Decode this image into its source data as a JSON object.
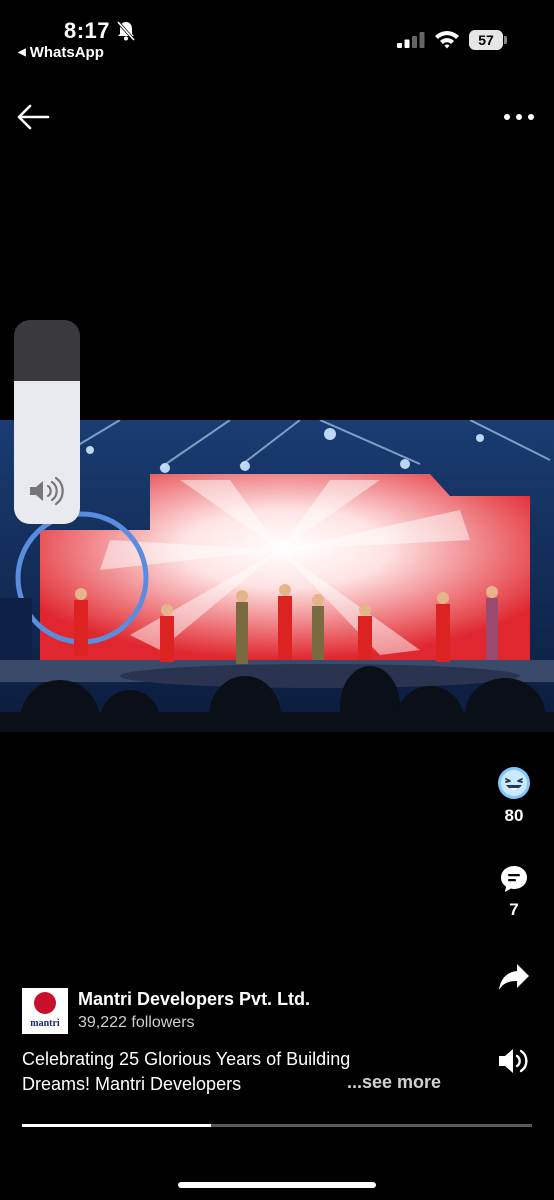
{
  "status_bar": {
    "time": "8:17",
    "back_app": "WhatsApp",
    "battery": "57",
    "icons": [
      "bell-slash-icon",
      "cellular-signal-icon",
      "wifi-icon",
      "battery-icon"
    ]
  },
  "nav": {
    "back_icon": "arrow-left-icon",
    "more_icon": "ellipsis-icon"
  },
  "video": {
    "description_icon": "video-player",
    "volume_level": 0.7
  },
  "reactions": {
    "icon": "laughing-face-icon",
    "count": "80"
  },
  "comments": {
    "icon": "comment-bubble-icon",
    "count": "7"
  },
  "share": {
    "icon": "share-arrow-icon"
  },
  "sound": {
    "icon": "speaker-icon"
  },
  "author": {
    "name": "Mantri Developers Pvt. Ltd.",
    "followers": "39,222 followers",
    "logo_text": "mantri"
  },
  "post": {
    "caption": "Celebrating 25 Glorious Years of Building Dreams! Mantri Developers",
    "see_more": "...see more"
  },
  "playback": {
    "progress": 0.37
  },
  "colors": {
    "background": "#000000",
    "accent_blue": "#7fc7ff",
    "brand_red": "#c8102e"
  }
}
